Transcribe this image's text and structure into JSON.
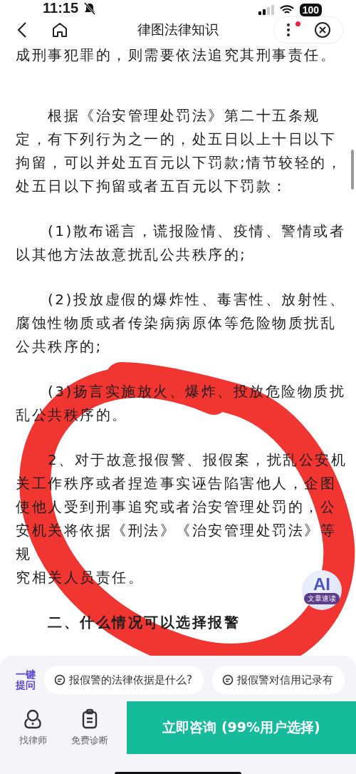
{
  "status_bar": {
    "time": "11:15",
    "battery": "100"
  },
  "nav": {
    "title": "律图法律知识",
    "has_notification": true
  },
  "article": {
    "paragraphs": [
      {
        "kind": "plain",
        "text": "成刑事犯罪的，则需要依法追究其刑事责任。"
      },
      {
        "kind": "indent",
        "text": "根据《治安管理处罚法》第二十五条规定，有下列行为之一的，处五日以上十日以下拘留，可以并处五百元以下罚款;情节较轻的，处五日以下拘留或者五百元以下罚款："
      },
      {
        "kind": "indent",
        "text": "(1)散布谣言，谎报险情、疫情、警情或者以其他方法故意扰乱公共秩序的;"
      },
      {
        "kind": "indent",
        "text": "(2)投放虚假的爆炸性、毒害性、放射性、腐蚀性物质或者传染病病原体等危险物质扰乱公共秩序的;"
      },
      {
        "kind": "indent",
        "text": "(3)扬言实施放火、爆炸、投放危险物质扰乱公共秩序的。"
      },
      {
        "kind": "indent",
        "text": "2、对于故意报假警、报假案，扰乱公安机关工作秩序或者捏造事实诬告陷害他人，企图使他人受到刑事追究或者治安管理处罚的，公安机关将依据《刑法》《治安管理处罚法》等规",
        "tail": "究相关人员责任。"
      },
      {
        "kind": "heading",
        "text": "二、什么情况可以选择报警"
      }
    ]
  },
  "ai_badge": {
    "label": "文章速读",
    "mark": "AI"
  },
  "quick_ask": {
    "label_top": "一键",
    "label_bottom": "提问",
    "chips": [
      "报假警的法律依据是什么?",
      "报假警对信用记录有"
    ]
  },
  "bottom_bar": {
    "actions": [
      {
        "kind": "person",
        "label": "找律师"
      },
      {
        "kind": "clipboard",
        "label": "免费诊断"
      }
    ],
    "cta": "立即咨询 (99%用户选择)"
  }
}
